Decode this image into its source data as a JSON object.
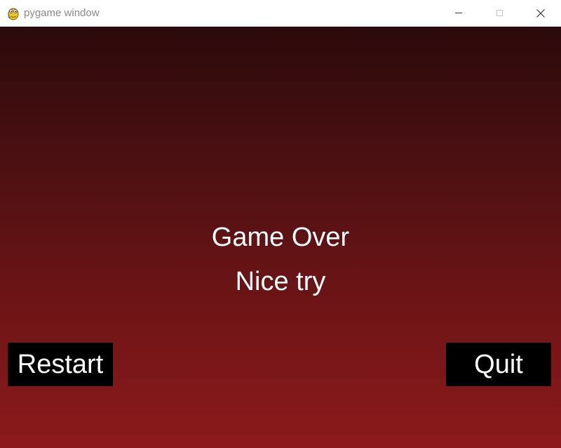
{
  "window": {
    "title": "pygame window",
    "icon": "pygame-snake-icon",
    "controls": [
      "minimize-icon",
      "maximize-icon",
      "close-icon"
    ]
  },
  "game": {
    "title": "Game Over",
    "subtitle": "Nice try",
    "buttons": {
      "restart_label": "Restart",
      "quit_label": "Quit"
    }
  },
  "colors": {
    "background_top": "#2c0a0b",
    "background_bottom": "#8c1a1c",
    "text": "#ffffff",
    "button_bg": "#000000"
  }
}
